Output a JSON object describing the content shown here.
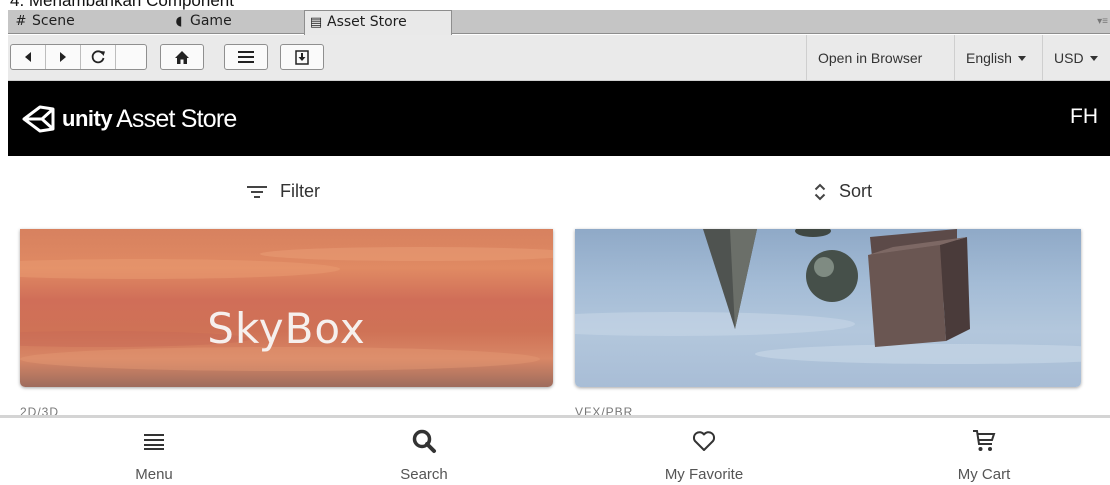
{
  "caption": "4.    Menambahkan Component",
  "tabs": [
    {
      "label": "Scene",
      "icon": "scene-icon"
    },
    {
      "label": "Game",
      "icon": "game-icon"
    },
    {
      "label": "Asset Store",
      "icon": "store-icon",
      "active": true
    }
  ],
  "toolbar": {
    "open_in_browser": "Open in Browser",
    "language": "English",
    "currency": "USD"
  },
  "header": {
    "brand": "unity",
    "store": "Asset Store",
    "user_initials": "FH"
  },
  "filterbar": {
    "filter_label": "Filter",
    "sort_label": "Sort"
  },
  "cards": [
    {
      "title": "SkyBox",
      "category_peek": "2D/3D"
    },
    {
      "title": "",
      "category_peek": "VFX/PBR"
    }
  ],
  "bottom_nav": [
    {
      "label": "Menu",
      "icon": "menu-icon"
    },
    {
      "label": "Search",
      "icon": "search-icon"
    },
    {
      "label": "My Favorite",
      "icon": "heart-icon"
    },
    {
      "label": "My Cart",
      "icon": "cart-icon"
    }
  ],
  "colors": {
    "header_bg": "#000000",
    "tabbar_bg": "#c5c5c5",
    "toolbar_bg": "#eaeaea"
  }
}
